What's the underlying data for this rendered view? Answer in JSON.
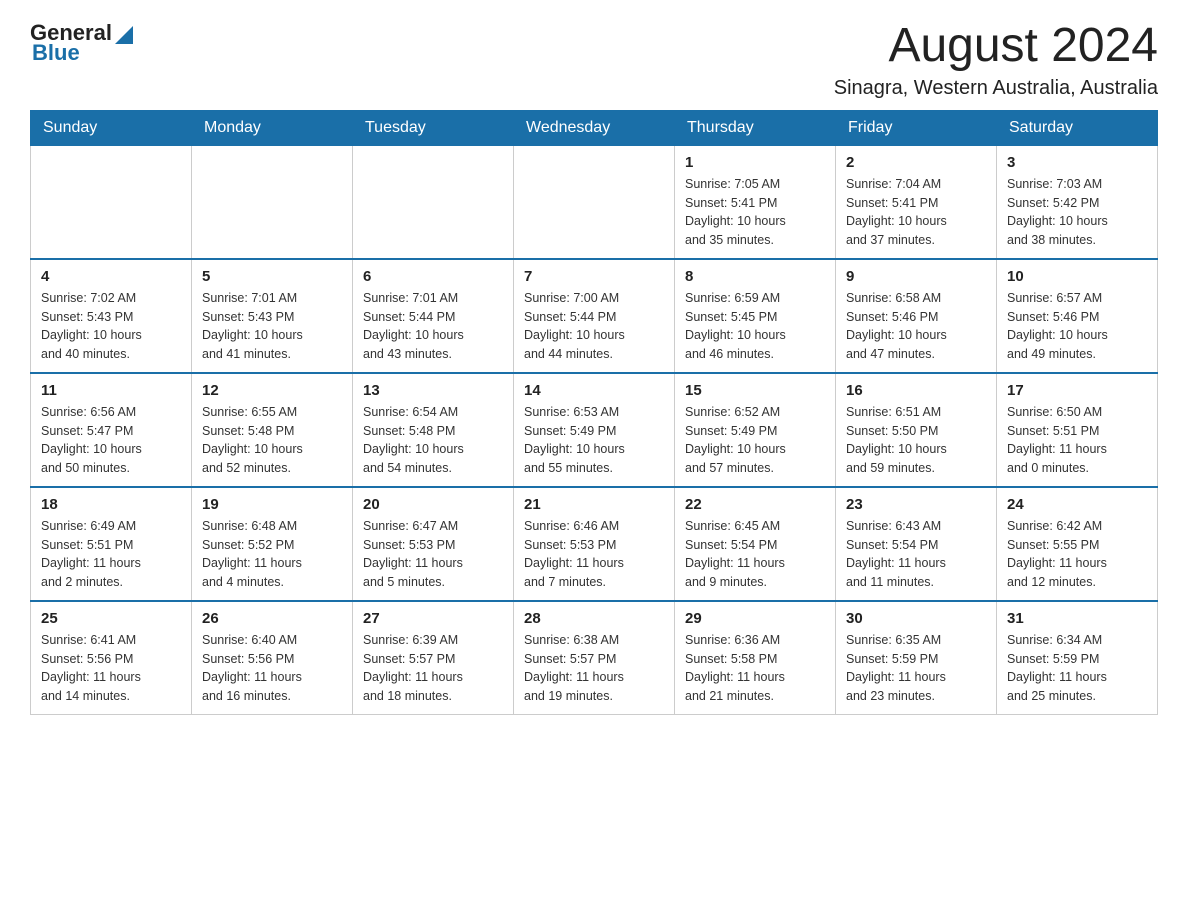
{
  "header": {
    "logo_general": "General",
    "logo_blue": "Blue",
    "month_title": "August 2024",
    "location": "Sinagra, Western Australia, Australia"
  },
  "days_of_week": [
    "Sunday",
    "Monday",
    "Tuesday",
    "Wednesday",
    "Thursday",
    "Friday",
    "Saturday"
  ],
  "weeks": [
    [
      {
        "day": "",
        "info": ""
      },
      {
        "day": "",
        "info": ""
      },
      {
        "day": "",
        "info": ""
      },
      {
        "day": "",
        "info": ""
      },
      {
        "day": "1",
        "info": "Sunrise: 7:05 AM\nSunset: 5:41 PM\nDaylight: 10 hours\nand 35 minutes."
      },
      {
        "day": "2",
        "info": "Sunrise: 7:04 AM\nSunset: 5:41 PM\nDaylight: 10 hours\nand 37 minutes."
      },
      {
        "day": "3",
        "info": "Sunrise: 7:03 AM\nSunset: 5:42 PM\nDaylight: 10 hours\nand 38 minutes."
      }
    ],
    [
      {
        "day": "4",
        "info": "Sunrise: 7:02 AM\nSunset: 5:43 PM\nDaylight: 10 hours\nand 40 minutes."
      },
      {
        "day": "5",
        "info": "Sunrise: 7:01 AM\nSunset: 5:43 PM\nDaylight: 10 hours\nand 41 minutes."
      },
      {
        "day": "6",
        "info": "Sunrise: 7:01 AM\nSunset: 5:44 PM\nDaylight: 10 hours\nand 43 minutes."
      },
      {
        "day": "7",
        "info": "Sunrise: 7:00 AM\nSunset: 5:44 PM\nDaylight: 10 hours\nand 44 minutes."
      },
      {
        "day": "8",
        "info": "Sunrise: 6:59 AM\nSunset: 5:45 PM\nDaylight: 10 hours\nand 46 minutes."
      },
      {
        "day": "9",
        "info": "Sunrise: 6:58 AM\nSunset: 5:46 PM\nDaylight: 10 hours\nand 47 minutes."
      },
      {
        "day": "10",
        "info": "Sunrise: 6:57 AM\nSunset: 5:46 PM\nDaylight: 10 hours\nand 49 minutes."
      }
    ],
    [
      {
        "day": "11",
        "info": "Sunrise: 6:56 AM\nSunset: 5:47 PM\nDaylight: 10 hours\nand 50 minutes."
      },
      {
        "day": "12",
        "info": "Sunrise: 6:55 AM\nSunset: 5:48 PM\nDaylight: 10 hours\nand 52 minutes."
      },
      {
        "day": "13",
        "info": "Sunrise: 6:54 AM\nSunset: 5:48 PM\nDaylight: 10 hours\nand 54 minutes."
      },
      {
        "day": "14",
        "info": "Sunrise: 6:53 AM\nSunset: 5:49 PM\nDaylight: 10 hours\nand 55 minutes."
      },
      {
        "day": "15",
        "info": "Sunrise: 6:52 AM\nSunset: 5:49 PM\nDaylight: 10 hours\nand 57 minutes."
      },
      {
        "day": "16",
        "info": "Sunrise: 6:51 AM\nSunset: 5:50 PM\nDaylight: 10 hours\nand 59 minutes."
      },
      {
        "day": "17",
        "info": "Sunrise: 6:50 AM\nSunset: 5:51 PM\nDaylight: 11 hours\nand 0 minutes."
      }
    ],
    [
      {
        "day": "18",
        "info": "Sunrise: 6:49 AM\nSunset: 5:51 PM\nDaylight: 11 hours\nand 2 minutes."
      },
      {
        "day": "19",
        "info": "Sunrise: 6:48 AM\nSunset: 5:52 PM\nDaylight: 11 hours\nand 4 minutes."
      },
      {
        "day": "20",
        "info": "Sunrise: 6:47 AM\nSunset: 5:53 PM\nDaylight: 11 hours\nand 5 minutes."
      },
      {
        "day": "21",
        "info": "Sunrise: 6:46 AM\nSunset: 5:53 PM\nDaylight: 11 hours\nand 7 minutes."
      },
      {
        "day": "22",
        "info": "Sunrise: 6:45 AM\nSunset: 5:54 PM\nDaylight: 11 hours\nand 9 minutes."
      },
      {
        "day": "23",
        "info": "Sunrise: 6:43 AM\nSunset: 5:54 PM\nDaylight: 11 hours\nand 11 minutes."
      },
      {
        "day": "24",
        "info": "Sunrise: 6:42 AM\nSunset: 5:55 PM\nDaylight: 11 hours\nand 12 minutes."
      }
    ],
    [
      {
        "day": "25",
        "info": "Sunrise: 6:41 AM\nSunset: 5:56 PM\nDaylight: 11 hours\nand 14 minutes."
      },
      {
        "day": "26",
        "info": "Sunrise: 6:40 AM\nSunset: 5:56 PM\nDaylight: 11 hours\nand 16 minutes."
      },
      {
        "day": "27",
        "info": "Sunrise: 6:39 AM\nSunset: 5:57 PM\nDaylight: 11 hours\nand 18 minutes."
      },
      {
        "day": "28",
        "info": "Sunrise: 6:38 AM\nSunset: 5:57 PM\nDaylight: 11 hours\nand 19 minutes."
      },
      {
        "day": "29",
        "info": "Sunrise: 6:36 AM\nSunset: 5:58 PM\nDaylight: 11 hours\nand 21 minutes."
      },
      {
        "day": "30",
        "info": "Sunrise: 6:35 AM\nSunset: 5:59 PM\nDaylight: 11 hours\nand 23 minutes."
      },
      {
        "day": "31",
        "info": "Sunrise: 6:34 AM\nSunset: 5:59 PM\nDaylight: 11 hours\nand 25 minutes."
      }
    ]
  ]
}
